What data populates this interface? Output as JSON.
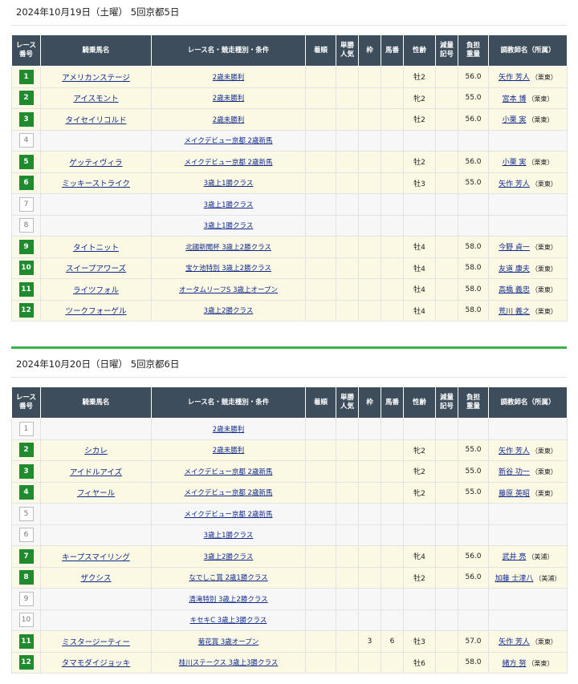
{
  "headers": {
    "race_no": [
      "レース",
      "番号"
    ],
    "horse": "騎乗馬名",
    "race": "レース名・競走種別・条件",
    "result": "着順",
    "pop": [
      "単勝",
      "人気"
    ],
    "frame": "枠",
    "num": "馬番",
    "sex": "性齢",
    "mark": [
      "減量",
      "記号"
    ],
    "weight": [
      "負担",
      "重量"
    ],
    "trainer": "調教師名（所属）"
  },
  "days": [
    {
      "title": "2024年10月19日（土曜） 5回京都5日",
      "races": [
        {
          "no": "1",
          "horse": "アメリカンステージ",
          "race": "2歳未勝利",
          "result": "",
          "pop": "",
          "frame": "",
          "num": "",
          "sex": "牡2",
          "mark": "",
          "weight": "56.0",
          "trainer": "矢作 芳人",
          "aff": "（栗東）"
        },
        {
          "no": "2",
          "horse": "アイスモント",
          "race": "2歳未勝利",
          "result": "",
          "pop": "",
          "frame": "",
          "num": "",
          "sex": "牝2",
          "mark": "",
          "weight": "55.0",
          "trainer": "宮本 博",
          "aff": "（栗東）"
        },
        {
          "no": "3",
          "horse": "タイセイリコルド",
          "race": "2歳未勝利",
          "result": "",
          "pop": "",
          "frame": "",
          "num": "",
          "sex": "牡2",
          "mark": "",
          "weight": "56.0",
          "trainer": "小栗 実",
          "aff": "（栗東）"
        },
        {
          "no": "4",
          "horse": "",
          "race": "メイクデビュー京都 2歳新馬",
          "result": "",
          "pop": "",
          "frame": "",
          "num": "",
          "sex": "",
          "mark": "",
          "weight": "",
          "trainer": "",
          "aff": ""
        },
        {
          "no": "5",
          "horse": "ゲッティヴィラ",
          "race": "メイクデビュー京都 2歳新馬",
          "result": "",
          "pop": "",
          "frame": "",
          "num": "",
          "sex": "牡2",
          "mark": "",
          "weight": "56.0",
          "trainer": "小栗 実",
          "aff": "（栗東）"
        },
        {
          "no": "6",
          "horse": "ミッキーストライク",
          "race": "3歳上1勝クラス",
          "result": "",
          "pop": "",
          "frame": "",
          "num": "",
          "sex": "牡3",
          "mark": "",
          "weight": "55.0",
          "trainer": "矢作 芳人",
          "aff": "（栗東）"
        },
        {
          "no": "7",
          "horse": "",
          "race": "3歳上1勝クラス",
          "result": "",
          "pop": "",
          "frame": "",
          "num": "",
          "sex": "",
          "mark": "",
          "weight": "",
          "trainer": "",
          "aff": ""
        },
        {
          "no": "8",
          "horse": "",
          "race": "3歳上1勝クラス",
          "result": "",
          "pop": "",
          "frame": "",
          "num": "",
          "sex": "",
          "mark": "",
          "weight": "",
          "trainer": "",
          "aff": ""
        },
        {
          "no": "9",
          "horse": "タイトニット",
          "race": "北國新聞杯 3歳上2勝クラス",
          "result": "",
          "pop": "",
          "frame": "",
          "num": "",
          "sex": "牡4",
          "mark": "",
          "weight": "58.0",
          "trainer": "今野 貞一",
          "aff": "（栗東）"
        },
        {
          "no": "10",
          "horse": "スイープアワーズ",
          "race": "宝ケ池特別 3歳上2勝クラス",
          "result": "",
          "pop": "",
          "frame": "",
          "num": "",
          "sex": "牡4",
          "mark": "",
          "weight": "58.0",
          "trainer": "友道 康夫",
          "aff": "（栗東）"
        },
        {
          "no": "11",
          "horse": "ライツフォル",
          "race": "オータムリーフS 3歳上オープン",
          "result": "",
          "pop": "",
          "frame": "",
          "num": "",
          "sex": "牡4",
          "mark": "",
          "weight": "58.0",
          "trainer": "高橋 義忠",
          "aff": "（栗東）"
        },
        {
          "no": "12",
          "horse": "ツークフォーゲル",
          "race": "3歳上2勝クラス",
          "result": "",
          "pop": "",
          "frame": "",
          "num": "",
          "sex": "牡4",
          "mark": "",
          "weight": "58.0",
          "trainer": "荒川 義之",
          "aff": "（栗東）"
        }
      ]
    },
    {
      "title": "2024年10月20日（日曜） 5回京都6日",
      "races": [
        {
          "no": "1",
          "horse": "",
          "race": "2歳未勝利",
          "result": "",
          "pop": "",
          "frame": "",
          "num": "",
          "sex": "",
          "mark": "",
          "weight": "",
          "trainer": "",
          "aff": ""
        },
        {
          "no": "2",
          "horse": "シカレ",
          "race": "2歳未勝利",
          "result": "",
          "pop": "",
          "frame": "",
          "num": "",
          "sex": "牝2",
          "mark": "",
          "weight": "55.0",
          "trainer": "矢作 芳人",
          "aff": "（栗東）"
        },
        {
          "no": "3",
          "horse": "アイドルアイズ",
          "race": "メイクデビュー京都 2歳新馬",
          "result": "",
          "pop": "",
          "frame": "",
          "num": "",
          "sex": "牝2",
          "mark": "",
          "weight": "55.0",
          "trainer": "新谷 功一",
          "aff": "（栗東）"
        },
        {
          "no": "4",
          "horse": "フィヤール",
          "race": "メイクデビュー京都 2歳新馬",
          "result": "",
          "pop": "",
          "frame": "",
          "num": "",
          "sex": "牝2",
          "mark": "",
          "weight": "55.0",
          "trainer": "藤原 英昭",
          "aff": "（栗東）"
        },
        {
          "no": "5",
          "horse": "",
          "race": "メイクデビュー京都 2歳新馬",
          "result": "",
          "pop": "",
          "frame": "",
          "num": "",
          "sex": "",
          "mark": "",
          "weight": "",
          "trainer": "",
          "aff": ""
        },
        {
          "no": "6",
          "horse": "",
          "race": "3歳上1勝クラス",
          "result": "",
          "pop": "",
          "frame": "",
          "num": "",
          "sex": "",
          "mark": "",
          "weight": "",
          "trainer": "",
          "aff": ""
        },
        {
          "no": "7",
          "horse": "キープスマイリング",
          "race": "3歳上2勝クラス",
          "result": "",
          "pop": "",
          "frame": "",
          "num": "",
          "sex": "牝4",
          "mark": "",
          "weight": "56.0",
          "trainer": "武井 亮",
          "aff": "（美浦）"
        },
        {
          "no": "8",
          "horse": "ザクシス",
          "race": "なでしこ賞 2歳1勝クラス",
          "result": "",
          "pop": "",
          "frame": "",
          "num": "",
          "sex": "牡2",
          "mark": "",
          "weight": "56.0",
          "trainer": "加藤 士津八",
          "aff": "（美浦）"
        },
        {
          "no": "9",
          "horse": "",
          "race": "清滝特別 3歳上2勝クラス",
          "result": "",
          "pop": "",
          "frame": "",
          "num": "",
          "sex": "",
          "mark": "",
          "weight": "",
          "trainer": "",
          "aff": ""
        },
        {
          "no": "10",
          "horse": "",
          "race": "キセキC 3歳上3勝クラス",
          "result": "",
          "pop": "",
          "frame": "",
          "num": "",
          "sex": "",
          "mark": "",
          "weight": "",
          "trainer": "",
          "aff": ""
        },
        {
          "no": "11",
          "horse": "ミスタージーティー",
          "race": "菊花賞 3歳オープン",
          "result": "",
          "pop": "",
          "frame": "3",
          "num": "6",
          "sex": "牡3",
          "mark": "",
          "weight": "57.0",
          "trainer": "矢作 芳人",
          "aff": "（栗東）"
        },
        {
          "no": "12",
          "horse": "タマモダイジョッキ",
          "race": "桂川ステークス 3歳上3勝クラス",
          "result": "",
          "pop": "",
          "frame": "",
          "num": "",
          "sex": "牡6",
          "mark": "",
          "weight": "58.0",
          "trainer": "緒方 努",
          "aff": "（栗東）"
        }
      ]
    }
  ]
}
